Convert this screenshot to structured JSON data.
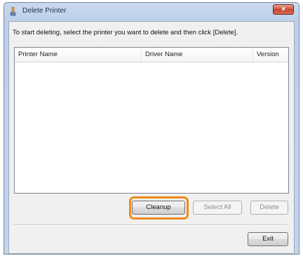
{
  "window": {
    "title": "Delete Printer",
    "close_label": "×"
  },
  "instruction": "To start deleting, select the printer you want to delete and then click [Delete].",
  "list": {
    "columns": [
      "Printer Name",
      "Driver Name",
      "Version"
    ],
    "rows": []
  },
  "buttons": {
    "cleanup": "Cleanup",
    "select_all": "Select All",
    "delete": "Delete",
    "exit": "Exit"
  },
  "colors": {
    "highlight": "#f08a1d",
    "title_gradient": "#bcd0ea",
    "close_button": "#c24730"
  },
  "icons": {
    "title_icon": "printer-icon",
    "close_icon": "close-icon"
  }
}
